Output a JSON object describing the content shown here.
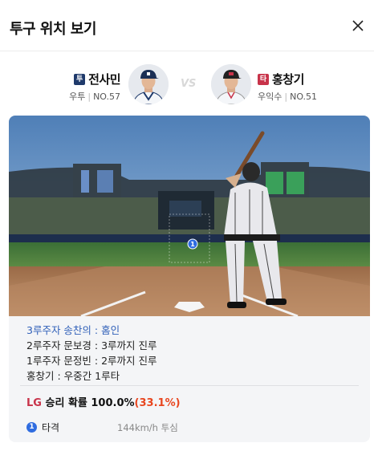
{
  "header": {
    "title": "투구 위치 보기"
  },
  "pitcher": {
    "badge": "투",
    "name": "전사민",
    "hand": "우투",
    "number": "NO.57"
  },
  "batter": {
    "badge": "타",
    "name": "홍창기",
    "hand": "우익수",
    "number": "NO.51"
  },
  "vs": "VS",
  "scene": {
    "pitch_marker": "1"
  },
  "events": [
    {
      "text": "3루주자 송찬의 : 홈인",
      "highlight": true
    },
    {
      "text": "2루주자 문보경 : 3루까지 진루",
      "highlight": false
    },
    {
      "text": "1루주자 문정빈 : 2루까지 진루",
      "highlight": false
    },
    {
      "text": "홍창기 : 우중간 1루타",
      "highlight": false
    }
  ],
  "win_probability": {
    "team": "LG",
    "label": " 승리 확률 ",
    "value": "100.0%",
    "delta": "(33.1%)"
  },
  "pitch": {
    "number": "1",
    "result": "타격",
    "speed": "144km/h 투심"
  },
  "colors": {
    "pitcher_badge": "#1f3a6b",
    "batter_badge": "#c8334a",
    "highlight_text": "#2f5fb8",
    "delta": "#e8461f",
    "pitch_marker": "#2f6ce0"
  }
}
